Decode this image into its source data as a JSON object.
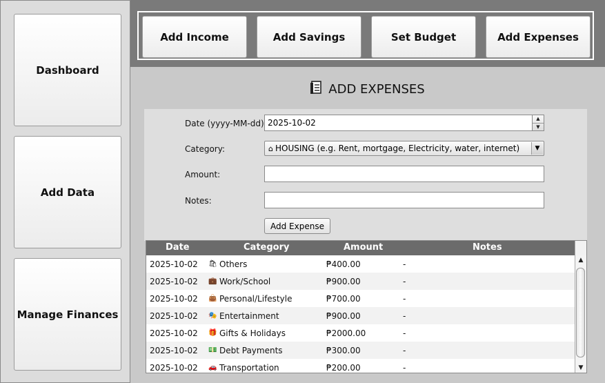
{
  "sidebar": {
    "items": [
      {
        "label": "Dashboard"
      },
      {
        "label": "Add Data"
      },
      {
        "label": "Manage Finances"
      }
    ]
  },
  "toolbar": {
    "buttons": [
      {
        "label": "Add Income"
      },
      {
        "label": "Add Savings"
      },
      {
        "label": "Set Budget"
      },
      {
        "label": "Add Expenses"
      }
    ]
  },
  "page": {
    "title": "ADD EXPENSES",
    "title_icon": "receipt-icon"
  },
  "form": {
    "date_label": "Date (yyyy-MM-dd):",
    "date_value": "2025-10-02",
    "category_label": "Category:",
    "category_icon": "house-icon",
    "category_value": "HOUSING (e.g. Rent, mortgage, Electricity, water, internet)",
    "amount_label": "Amount:",
    "amount_value": "",
    "notes_label": "Notes:",
    "notes_value": "",
    "submit_label": "Add Expense"
  },
  "table": {
    "columns": [
      "Date",
      "Category",
      "Amount",
      "Notes"
    ],
    "rows": [
      {
        "date": "2025-10-02",
        "icon": "🛍",
        "category": "Others",
        "amount": "₱400.00",
        "notes": "-"
      },
      {
        "date": "2025-10-02",
        "icon": "💼",
        "category": "Work/School",
        "amount": "₱900.00",
        "notes": "-"
      },
      {
        "date": "2025-10-02",
        "icon": "👜",
        "category": "Personal/Lifestyle",
        "amount": "₱700.00",
        "notes": "-"
      },
      {
        "date": "2025-10-02",
        "icon": "🎭",
        "category": "Entertainment",
        "amount": "₱900.00",
        "notes": "-"
      },
      {
        "date": "2025-10-02",
        "icon": "🎁",
        "category": "Gifts & Holidays",
        "amount": "₱2000.00",
        "notes": "-"
      },
      {
        "date": "2025-10-02",
        "icon": "💵",
        "category": "Debt Payments",
        "amount": "₱300.00",
        "notes": "-"
      },
      {
        "date": "2025-10-02",
        "icon": "🚗",
        "category": "Transportation",
        "amount": "₱200.00",
        "notes": "-"
      }
    ]
  }
}
